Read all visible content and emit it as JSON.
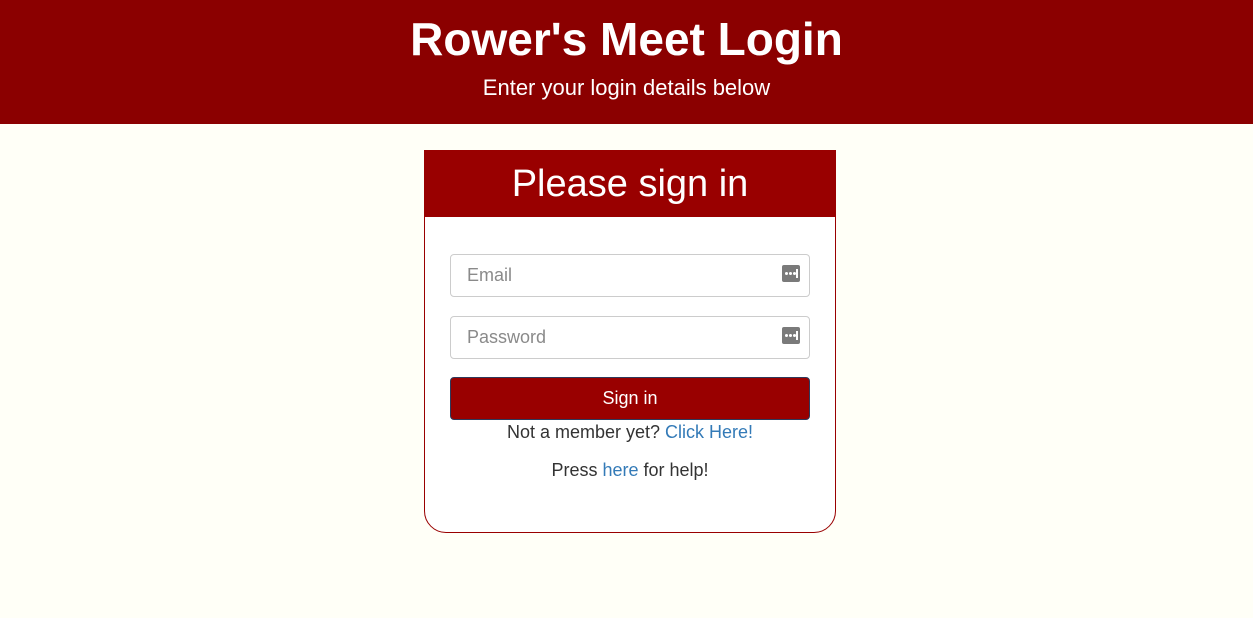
{
  "header": {
    "title": "Rower's Meet Login",
    "subtitle": "Enter your login details below"
  },
  "card": {
    "title": "Please sign in",
    "email": {
      "placeholder": "Email",
      "value": "",
      "icon": "password-manager-icon"
    },
    "password": {
      "placeholder": "Password",
      "value": "",
      "icon": "password-manager-icon"
    },
    "signin_label": "Sign in",
    "register": {
      "prefix": "Not a member yet? ",
      "link_text": "Click Here!"
    },
    "help": {
      "prefix": "Press ",
      "link_text": "here",
      "suffix": " for help!"
    }
  },
  "colors": {
    "header_bg": "#8b0000",
    "card_accent": "#990000",
    "page_bg": "#fffff7",
    "link": "#337ab7"
  }
}
